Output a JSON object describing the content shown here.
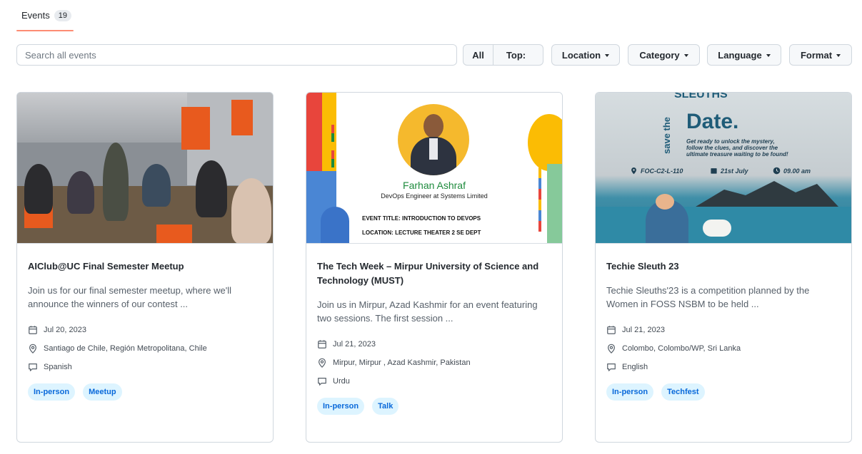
{
  "tabs": [
    {
      "label": "Events",
      "count": "19"
    }
  ],
  "search": {
    "placeholder": "Search all events"
  },
  "filters": {
    "all": "All",
    "top": "Top:",
    "location": "Location",
    "category": "Category",
    "language": "Language",
    "format": "Format"
  },
  "cards": [
    {
      "title": "AIClub@UC Final Semester Meetup",
      "description": "Join us for our final semester meetup, where we'll announce the winners of our contest ...",
      "date": "Jul 20, 2023",
      "location": "Santiago de Chile, Región Metropolitana, Chile",
      "language": "Spanish",
      "tags": [
        "In-person",
        "Meetup"
      ]
    },
    {
      "title": "The Tech Week – Mirpur University of Science and Technology (MUST)",
      "description": "Join us in Mirpur, Azad Kashmir for an event featuring two sessions. The first session ...",
      "date": "Jul 21, 2023",
      "location": "Mirpur, Mirpur , Azad Kashmir, Pakistan",
      "language": "Urdu",
      "tags": [
        "In-person",
        "Talk"
      ],
      "poster": {
        "name": "Farhan Ashraf",
        "role": "DevOps Engineer at Systems Limited",
        "event_line": "EVENT TITLE: INTRODUCTION TO DEVOPS",
        "location_line": "LOCATION: LECTURE THEATER 2 SE DEPT"
      }
    },
    {
      "title": "Techie Sleuth 23",
      "description": "Techie Sleuths'23 is a competition planned by the Women in FOSS NSBM to be held ...",
      "date": "Jul 21, 2023",
      "location": "Colombo, Colombo/WP, Sri Lanka",
      "language": "English",
      "tags": [
        "In-person",
        "Techfest"
      ],
      "poster": {
        "top": "SLEUTHS",
        "save": "save the",
        "date_word": "Date.",
        "sub1": "Get ready to unlock the mystery,",
        "sub2": "follow the clues, and discover the",
        "sub3": "ultimate treasure waiting to be found!",
        "venue": "FOC-C2-L-110",
        "day": "21st July",
        "time": "09.00 am"
      }
    }
  ],
  "colors": {
    "tab_underline": "#fd8c73",
    "tag_bg": "#ddf4ff",
    "tag_text": "#0969da"
  }
}
